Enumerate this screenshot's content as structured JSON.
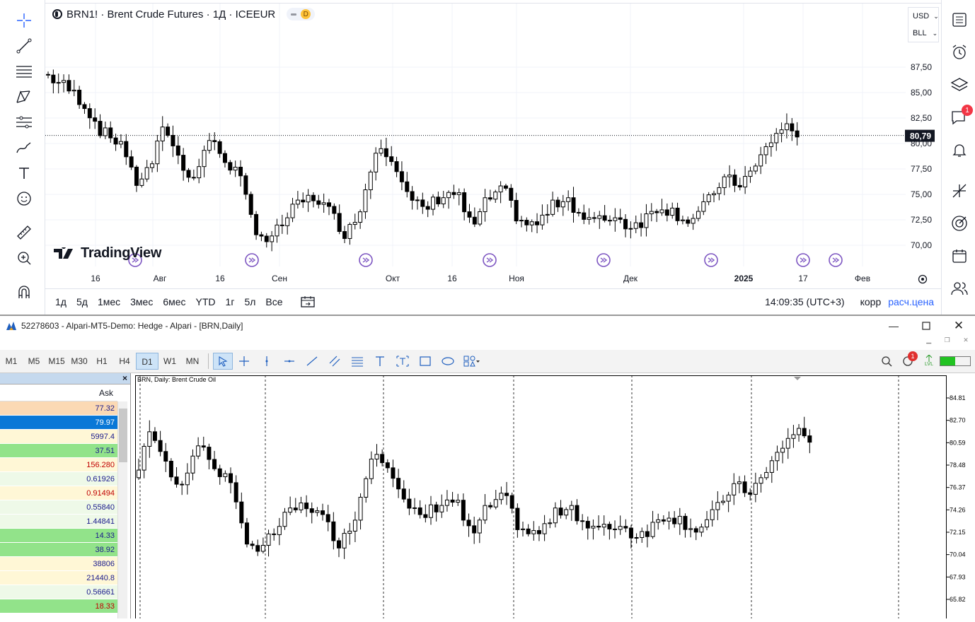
{
  "tradingview": {
    "symbol_title": "BRN1! · Brent Crude Futures · 1Д · ICEEUR",
    "badge": "D",
    "currency": "USD",
    "unit": "BLL",
    "logo": "TradingView",
    "last_price": "80,79",
    "price_axis": [
      "87,50",
      "85,00",
      "82,50",
      "80,00",
      "77,50",
      "75,00",
      "72,50",
      "70,00"
    ],
    "time_axis": [
      "16",
      "Авг",
      "16",
      "Сен",
      "Окт",
      "16",
      "Ноя",
      "Дек",
      "2025",
      "17",
      "Фев"
    ],
    "ranges": [
      "1д",
      "5д",
      "1мес",
      "3мес",
      "6мес",
      "YTD",
      "1г",
      "5л",
      "Все"
    ],
    "clock": "14:09:35 (UTC+3)",
    "adjust": "корр",
    "settlement": "расч.цена",
    "notification_count": "1",
    "accent": "#2962ff",
    "up_color": "#ffffff",
    "down_color": "#000000"
  },
  "mt5": {
    "window_title": "52278603 - Alpari-MT5-Demo: Hedge - Alpari - [BRN,Daily]",
    "timeframes": [
      "M1",
      "M5",
      "M15",
      "M30",
      "H1",
      "H4",
      "D1",
      "W1",
      "MN"
    ],
    "active_timeframe": "D1",
    "chart_label": "BRN, Daily:  Brent Crude Oil",
    "notification_count": "1",
    "lvl_label": "LVL",
    "price_axis": [
      "84.81",
      "82.70",
      "80.59",
      "78.48",
      "76.37",
      "74.26",
      "72.15",
      "70.04",
      "67.93",
      "65.82"
    ],
    "market_watch": {
      "close_label": "×",
      "column": "Ask",
      "rows": [
        {
          "value": "77.32",
          "bg": "#fbd9b4",
          "color": "#1a1a8c"
        },
        {
          "value": "79.97",
          "bg": "#0a78d7",
          "color": "#ffffff"
        },
        {
          "value": "5997.4",
          "bg": "#fff7d6",
          "color": "#1a1a8c"
        },
        {
          "value": "37.51",
          "bg": "#92e38a",
          "color": "#1a1a8c"
        },
        {
          "value": "156.280",
          "bg": "#fff7d6",
          "color": "#c00000"
        },
        {
          "value": "0.61926",
          "bg": "#eef9e8",
          "color": "#1a1a8c"
        },
        {
          "value": "0.91494",
          "bg": "#fff7d6",
          "color": "#c00000"
        },
        {
          "value": "0.55840",
          "bg": "#eef9e8",
          "color": "#1a1a8c"
        },
        {
          "value": "1.44841",
          "bg": "#eef9e8",
          "color": "#1a1a8c"
        },
        {
          "value": "14.33",
          "bg": "#92e38a",
          "color": "#1a1a8c"
        },
        {
          "value": "38.92",
          "bg": "#92e38a",
          "color": "#1a1a8c"
        },
        {
          "value": "38806",
          "bg": "#fff7d6",
          "color": "#1a1a8c"
        },
        {
          "value": "21440.8",
          "bg": "#fff7d6",
          "color": "#1a1a8c"
        },
        {
          "value": "0.56661",
          "bg": "#eef9e8",
          "color": "#1a1a8c"
        },
        {
          "value": "18.33",
          "bg": "#92e38a",
          "color": "#c00000"
        }
      ]
    }
  }
}
